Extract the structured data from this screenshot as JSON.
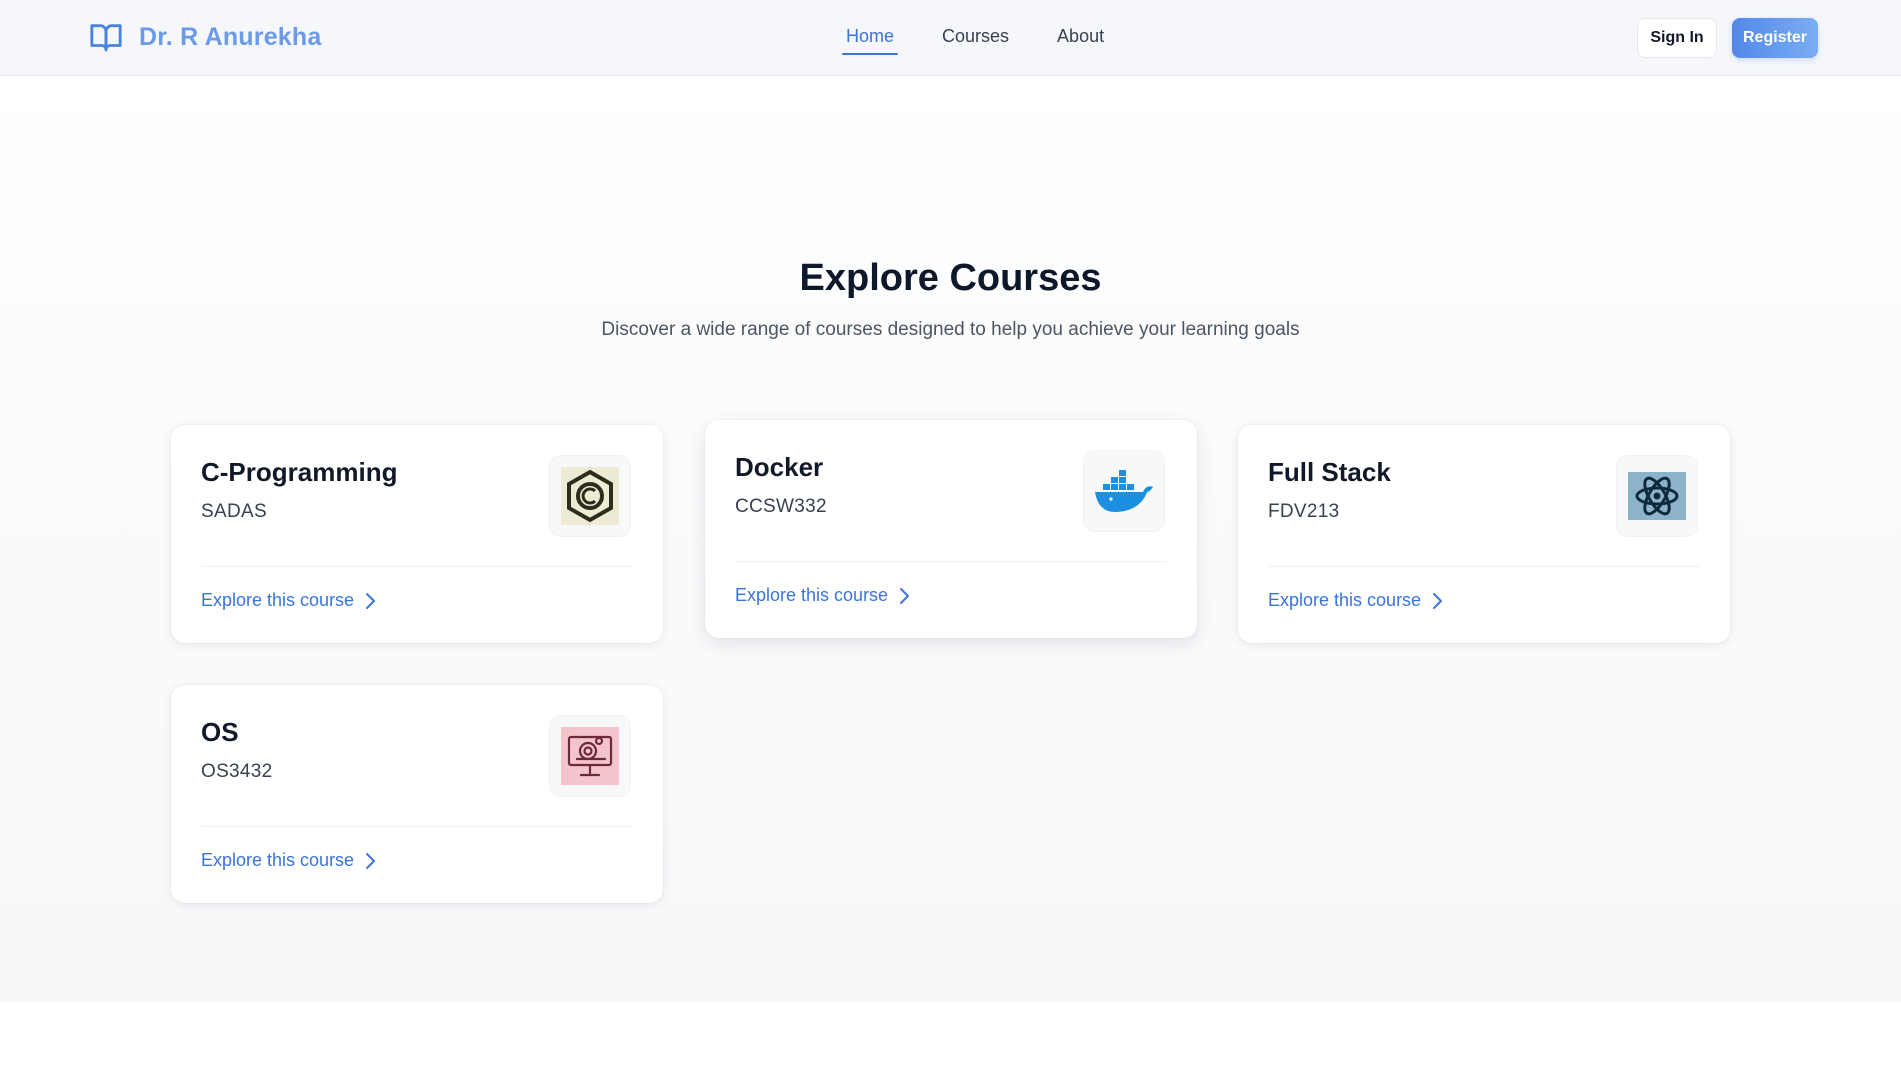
{
  "brand": {
    "name": "Dr. R Anurekha",
    "icon": "open-book-icon"
  },
  "nav": {
    "links": [
      {
        "label": "Home",
        "active": true
      },
      {
        "label": "Courses",
        "active": false
      },
      {
        "label": "About",
        "active": false
      }
    ],
    "signin_label": "Sign In",
    "register_label": "Register"
  },
  "hero": {
    "title": "Explore Courses",
    "subtitle": "Discover a wide range of courses designed to help you achieve your learning goals"
  },
  "courses": [
    {
      "title": "C-Programming",
      "code": "SADAS",
      "icon": "c-language-hexagon-icon",
      "link_label": "Explore this course"
    },
    {
      "title": "Docker",
      "code": "CCSW332",
      "icon": "docker-whale-icon",
      "link_label": "Explore this course"
    },
    {
      "title": "Full Stack",
      "code": "FDV213",
      "icon": "react-atom-icon",
      "link_label": "Explore this course"
    },
    {
      "title": "OS",
      "code": "OS3432",
      "icon": "computer-monitor-icon",
      "link_label": "Explore this course"
    }
  ],
  "colors": {
    "accent": "#3b74d9",
    "brand": "#6a9ae8",
    "register_start": "#5287ea",
    "register_end": "#7aaef3"
  }
}
